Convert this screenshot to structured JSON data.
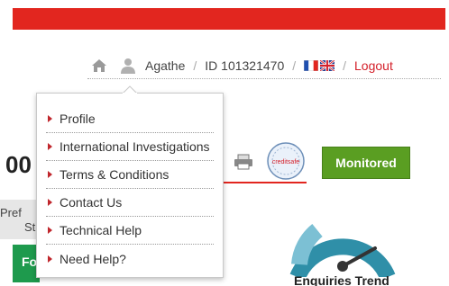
{
  "colors": {
    "brand_red": "#e2261f",
    "link_red": "#d4202a",
    "monitored_green": "#5a9e22",
    "gauge_teal": "#2f8fa8"
  },
  "userbar": {
    "home_icon": "home-icon",
    "user_icon": "user-icon",
    "username": "Agathe",
    "separator": "/",
    "user_id": "ID 101321470",
    "flags": [
      "flag-fr",
      "flag-gb"
    ],
    "logout": "Logout"
  },
  "menu": {
    "items": [
      {
        "label": "Profile"
      },
      {
        "label": "International Investigations"
      },
      {
        "label": "Terms & Conditions"
      },
      {
        "label": "Contact Us"
      },
      {
        "label": "Technical Help"
      },
      {
        "label": "Need Help?"
      }
    ]
  },
  "background": {
    "fragment_heading": "00",
    "pref_line1": "Pref",
    "pref_line2": "St",
    "button_fragment": "Fo",
    "monitored_label": "Monitored",
    "gauge_title": "Enquiries Trend",
    "badge_text": "creditsafe",
    "print_icon": "printer-icon"
  }
}
